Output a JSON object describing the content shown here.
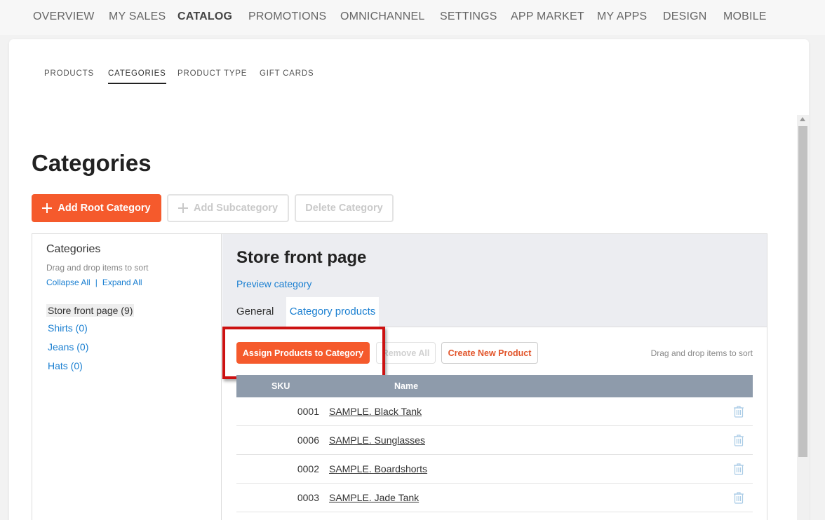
{
  "topnav": {
    "items": [
      {
        "label": "OVERVIEW"
      },
      {
        "label": "MY SALES"
      },
      {
        "label": "CATALOG"
      },
      {
        "label": "PROMOTIONS"
      },
      {
        "label": "OMNICHANNEL"
      },
      {
        "label": "SETTINGS"
      },
      {
        "label": "APP MARKET"
      },
      {
        "label": "MY APPS"
      },
      {
        "label": "DESIGN"
      },
      {
        "label": "MOBILE"
      }
    ],
    "active": "CATALOG"
  },
  "subtabs": {
    "items": [
      {
        "label": "PRODUCTS"
      },
      {
        "label": "CATEGORIES"
      },
      {
        "label": "PRODUCT TYPE"
      },
      {
        "label": "GIFT CARDS"
      }
    ],
    "active": "CATEGORIES"
  },
  "page": {
    "title": "Categories",
    "add_root_label": "Add Root Category",
    "add_sub_label": "Add Subcategory",
    "delete_label": "Delete Category"
  },
  "tree": {
    "title": "Categories",
    "hint": "Drag and drop items to sort",
    "collapse_label": "Collapse All",
    "separator": "|",
    "expand_label": "Expand All",
    "items": [
      {
        "label": "Store front page (9)"
      },
      {
        "label": "Shirts (0)"
      },
      {
        "label": "Jeans (0)"
      },
      {
        "label": "Hats (0)"
      }
    ]
  },
  "detail": {
    "title": "Store front page",
    "preview_label": "Preview category",
    "tabs": [
      {
        "label": "General"
      },
      {
        "label": "Category products"
      }
    ],
    "active_tab": "Category products",
    "assign_label": "Assign Products to Category",
    "remove_all_label": "Remove All",
    "create_label": "Create New Product",
    "drag_hint": "Drag and drop items to sort",
    "columns": {
      "sku": "SKU",
      "name": "Name"
    },
    "rows": [
      {
        "sku": "0001",
        "name": "SAMPLE. Black Tank"
      },
      {
        "sku": "0006",
        "name": "SAMPLE. Sunglasses"
      },
      {
        "sku": "0002",
        "name": "SAMPLE. Boardshorts"
      },
      {
        "sku": "0003",
        "name": "SAMPLE. Jade Tank"
      }
    ]
  },
  "colors": {
    "accent": "#f55a2c",
    "link": "#1a7fd1",
    "table_header": "#8e9bab",
    "highlight": "#cc1111"
  },
  "icons": {
    "row_action": "trash-icon",
    "add": "plus-icon"
  }
}
